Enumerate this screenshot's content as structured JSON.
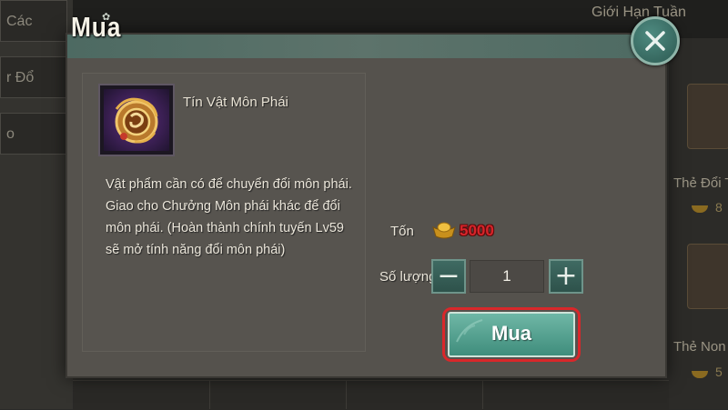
{
  "background": {
    "left_tabs": [
      "Các",
      "r Đổ",
      "o"
    ],
    "top_right_title": "Giới Hạn Tuần",
    "right_items": [
      {
        "label": "Thẻ Đổi Tên",
        "price": "8"
      },
      {
        "label": "Thẻ Non",
        "price": "5"
      }
    ]
  },
  "modal": {
    "title": "Mua",
    "item": {
      "name": "Tín Vật Môn Phái",
      "description": "Vật phẩm cần có để chuyển đổi môn phái. Giao cho Chưởng Môn phái khác để đổi môn phái. (Hoàn thành chính tuyến Lv59 sẽ mở tính năng đổi môn phái)"
    },
    "price": {
      "label": "Tốn",
      "value": "5000",
      "currency_icon": "gold-ingot-icon"
    },
    "quantity": {
      "label": "Số lượng",
      "value": "1",
      "minus": "−",
      "plus": "+"
    },
    "buy_button": "Mua",
    "close_icon": "close-icon"
  },
  "colors": {
    "accent_teal": "#4a9a88",
    "price_red": "#d8242a",
    "highlight_red": "#d9272a"
  }
}
